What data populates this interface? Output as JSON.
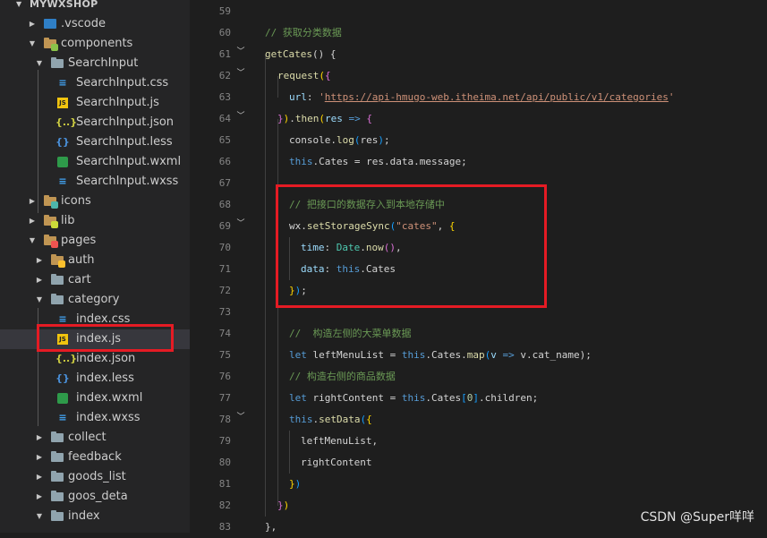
{
  "explorer": {
    "root": "MYWXSHOP",
    "items": [
      {
        "label": ".vscode"
      },
      {
        "label": "components"
      },
      {
        "label": "SearchInput"
      },
      {
        "label": "SearchInput.css"
      },
      {
        "label": "SearchInput.js"
      },
      {
        "label": "SearchInput.json"
      },
      {
        "label": "SearchInput.less"
      },
      {
        "label": "SearchInput.wxml"
      },
      {
        "label": "SearchInput.wxss"
      },
      {
        "label": "icons"
      },
      {
        "label": "lib"
      },
      {
        "label": "pages"
      },
      {
        "label": "auth"
      },
      {
        "label": "cart"
      },
      {
        "label": "category"
      },
      {
        "label": "index.css"
      },
      {
        "label": "index.js"
      },
      {
        "label": "index.json"
      },
      {
        "label": "index.less"
      },
      {
        "label": "index.wxml"
      },
      {
        "label": "index.wxss"
      },
      {
        "label": "collect"
      },
      {
        "label": "feedback"
      },
      {
        "label": "goods_list"
      },
      {
        "label": "goos_deta"
      },
      {
        "label": "index"
      }
    ]
  },
  "editor": {
    "line_numbers": [
      "59",
      "60",
      "61",
      "62",
      "63",
      "64",
      "65",
      "66",
      "67",
      "68",
      "69",
      "70",
      "71",
      "72",
      "73",
      "74",
      "75",
      "76",
      "77",
      "78",
      "79",
      "80",
      "81",
      "82",
      "83"
    ],
    "lines": {
      "l60_comment": "// 获取分类数据",
      "l61_fn": "getCates",
      "l61_rest": "() {",
      "l62_fn": "request",
      "l63_prop": "url",
      "l63_url": "https://api-hmugo-web.itheima.net/api/public/v1/categories",
      "l64_then": "then",
      "l64_param": "res",
      "l65_console": "console",
      "l65_log": "log",
      "l65_arg": "res",
      "l66_this": "this",
      "l66_rest": ".Cates = res.data.message;",
      "l68_comment": "// 把接口的数据存入到本地存储中",
      "l69_obj": "wx",
      "l69_fn": "setStorageSync",
      "l69_str": "\"cates\"",
      "l70_prop": "time",
      "l70_cls": "Date",
      "l70_fn": "now",
      "l71_prop": "data",
      "l71_this": "this",
      "l71_rest": ".Cates",
      "l74_comment": "//  构造左侧的大菜单数据",
      "l75_kw": "let",
      "l75_var": "leftMenuList",
      "l75_this": "this",
      "l75_map": "map",
      "l75_v": "v",
      "l75_rest": "v.cat_name);",
      "l76_comment": "// 构造右侧的商品数据",
      "l77_kw": "let",
      "l77_var": "rightContent",
      "l77_this": "this",
      "l77_idx": "0",
      "l77_rest": ".children;",
      "l78_this": "this",
      "l78_fn": "setData",
      "l79_prop": "leftMenuList,",
      "l80_prop": "rightContent"
    }
  },
  "watermark": "CSDN @Super咩咩"
}
